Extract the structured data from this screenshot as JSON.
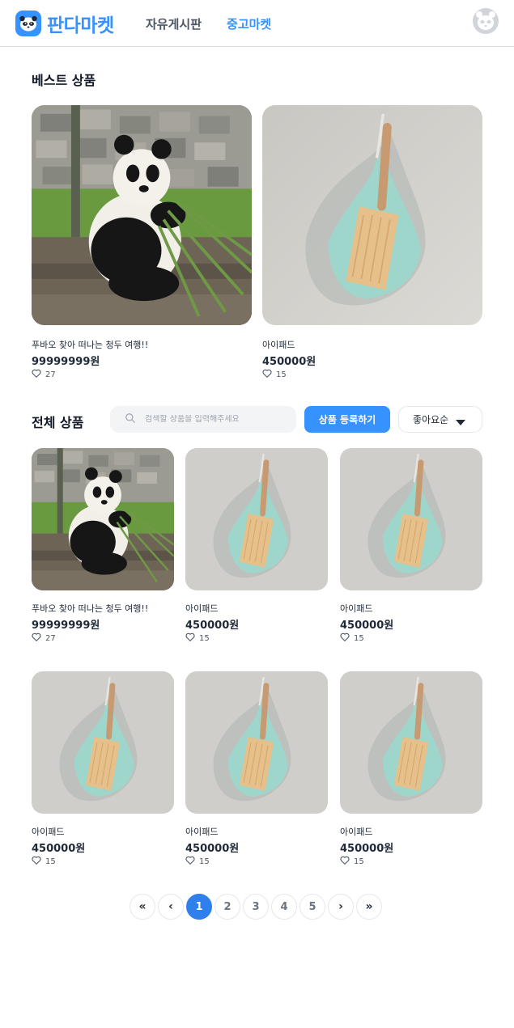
{
  "header": {
    "logo_text": "판다마켓",
    "nav": [
      "자유게시판",
      "중고마켓"
    ],
    "active_nav": "중고마켓",
    "brand_color": "#3692ff"
  },
  "best": {
    "title": "베스트 상품",
    "items": [
      {
        "name": "푸바오 찾아 떠나는 청두 여행!!",
        "price": "99999999원",
        "likes": "27",
        "image": "panda"
      },
      {
        "name": "아이패드",
        "price": "450000원",
        "likes": "15",
        "image": "dustpan"
      }
    ]
  },
  "all": {
    "title": "전체 상품",
    "search_placeholder": "검색할 상품을 입력해주세요",
    "register_label": "상품 등록하기",
    "sort_label": "좋아요순",
    "items": [
      {
        "name": "푸바오 찾아 떠나는 청두 여행!!",
        "price": "99999999원",
        "likes": "27",
        "image": "panda"
      },
      {
        "name": "아이패드",
        "price": "450000원",
        "likes": "15",
        "image": "dustpan"
      },
      {
        "name": "아이패드",
        "price": "450000원",
        "likes": "15",
        "image": "dustpan"
      },
      {
        "name": "아이패드",
        "price": "450000원",
        "likes": "15",
        "image": "dustpan"
      },
      {
        "name": "아이패드",
        "price": "450000원",
        "likes": "15",
        "image": "dustpan"
      },
      {
        "name": "아이패드",
        "price": "450000원",
        "likes": "15",
        "image": "dustpan"
      }
    ]
  },
  "pagination": {
    "first": "«",
    "prev": "‹",
    "pages": [
      "1",
      "2",
      "3",
      "4",
      "5"
    ],
    "current": "1",
    "next": "›",
    "last": "»"
  },
  "icons": {
    "search": "search-icon",
    "heart": "heart-icon",
    "caret": "caret-down-icon",
    "avatar": "default-avatar-icon"
  }
}
